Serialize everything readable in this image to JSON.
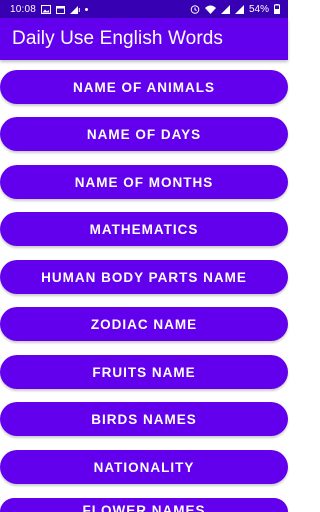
{
  "status_bar": {
    "time": "10:08",
    "battery": "54%",
    "left_icons": [
      "image-icon",
      "calendar-icon",
      "signal-alert-icon",
      "dot-icon"
    ],
    "right_icons": [
      "alarm-icon",
      "wifi-icon",
      "signal-icon",
      "signal-icon-2"
    ]
  },
  "app_bar": {
    "title": "Daily Use English Words"
  },
  "menu": {
    "items": [
      {
        "label": "NAME OF ANIMALS"
      },
      {
        "label": "NAME OF DAYS"
      },
      {
        "label": "NAME OF MONTHS"
      },
      {
        "label": "MATHEMATICS"
      },
      {
        "label": "HUMAN BODY PARTS NAME"
      },
      {
        "label": "ZODIAC NAME"
      },
      {
        "label": "FRUITS NAME"
      },
      {
        "label": "BIRDS NAMES"
      },
      {
        "label": "NATIONALITY"
      },
      {
        "label": "FLOWER NAMES"
      }
    ]
  },
  "colors": {
    "primary": "#6200ee",
    "primary_dark": "#3700b3",
    "on_primary": "#ffffff"
  }
}
